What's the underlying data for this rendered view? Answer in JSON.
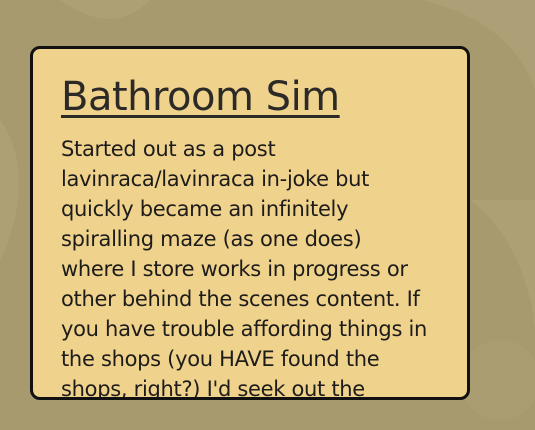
{
  "card": {
    "title": "Bathroom Sim",
    "body_lines": [
      "Started out as a post",
      "lavinraca/lavinraca in-joke but",
      "quickly became an infinitely",
      "spiralling maze (as one does)",
      "where I store works in progress or",
      "other behind the scenes content. If",
      "you have trouble affording things in",
      "the shops (you HAVE found the",
      "shops, right?) I'd seek out the"
    ]
  },
  "colors": {
    "background": "#a89a6f",
    "card_fill": "#efd28c",
    "card_border": "#111111",
    "title_text": "#2c2a26",
    "body_text": "#1e1c1a"
  }
}
